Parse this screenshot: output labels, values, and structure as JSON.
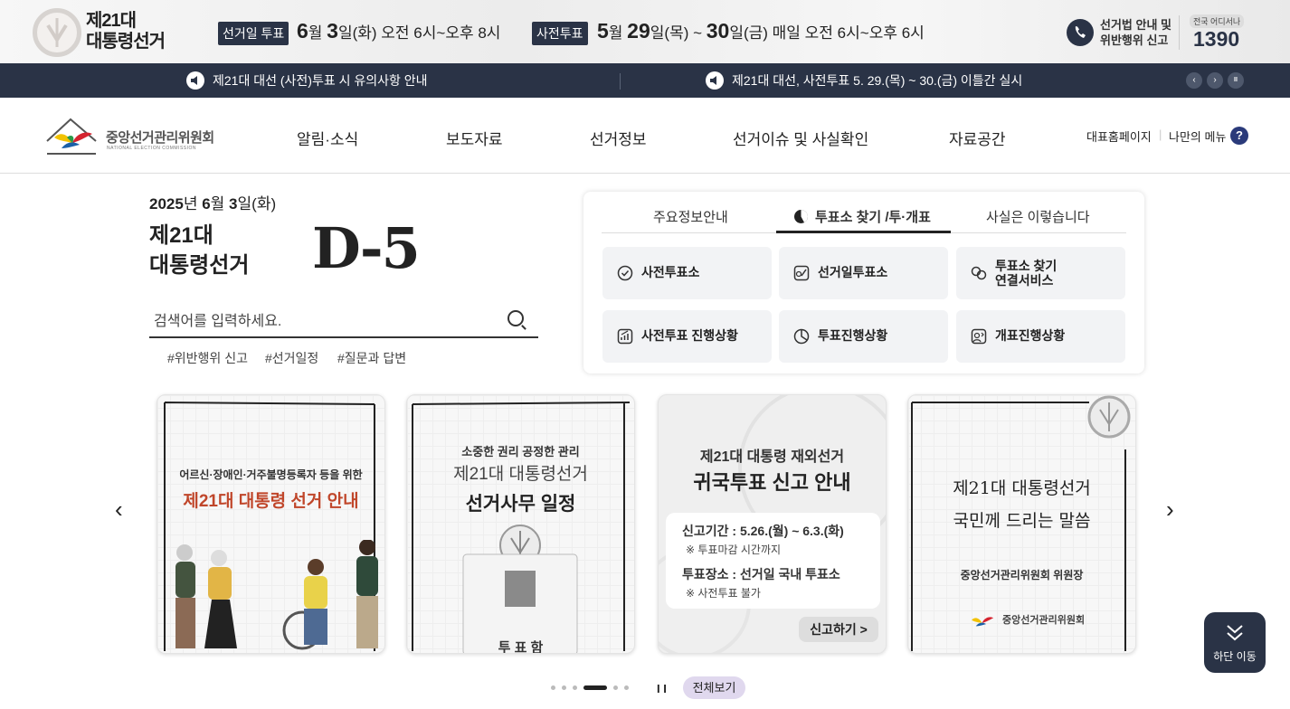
{
  "banner": {
    "brand_line1": "제21대",
    "brand_line2": "대통령선거",
    "election_day_tag": "선거일 투표",
    "election_day_month": "6",
    "election_day_month_unit": "월",
    "election_day_date": "3",
    "election_day_rest": "일(화) 오전 6시~오후 8시",
    "early_vote_tag": "사전투표",
    "early_vote_month": "5",
    "early_vote_month_unit": "월",
    "early_vote_start": "29",
    "early_vote_mid": "일(목) ~ ",
    "early_vote_end": "30",
    "early_vote_rest": "일(금) 매일 오전 6시~오후 6시",
    "hotline_line1": "선거법 안내 및",
    "hotline_line2": "위반행위 신고",
    "hotline_small": "전국 어디서나",
    "hotline_number": "1390"
  },
  "notices": [
    {
      "text": "제21대 대선 (사전)투표 시 유의사항 안내"
    },
    {
      "text": "제21대 대선, 사전투표 5. 29.(목) ~ 30.(금) 이틀간 실시"
    }
  ],
  "notice_controls": {
    "prev": "‹",
    "next": "›",
    "pause": "II"
  },
  "gnb": {
    "org_name": "중앙선거관리위원회",
    "org_name_en": "NATIONAL ELECTION COMMISSION",
    "menu": [
      "알림·소식",
      "보도자료",
      "선거정보",
      "선거이슈 및 사실확인",
      "자료공간"
    ],
    "util_home": "대표홈페이지",
    "util_my": "나만의 메뉴",
    "help": "?"
  },
  "hero": {
    "date_year": "2025",
    "date_year_unit": "년 ",
    "date_month": "6",
    "date_month_unit": "월 ",
    "date_day": "3",
    "date_rest": "일(화)",
    "election_line1": "제21대",
    "election_line2": "대통령선거",
    "dday": "D-5",
    "search_placeholder": "검색어를 입력하세요.",
    "hashtags": [
      "#위반행위 신고",
      "#선거일정",
      "#질문과 답변"
    ]
  },
  "panel": {
    "tabs": [
      "주요정보안내",
      "투표소 찾기 /투·개표",
      "사실은 이렇습니다"
    ],
    "buttons": [
      {
        "label": "사전투표소",
        "icon": "check-circle-icon"
      },
      {
        "label": "선거일투표소",
        "icon": "ballot-icon"
      },
      {
        "label_line1": "투표소 찾기",
        "label_line2": "연결서비스",
        "icon": "link-icon"
      },
      {
        "label": "사전투표 진행상황",
        "icon": "growth-chart-icon"
      },
      {
        "label": "투표진행상황",
        "icon": "pie-chart-icon"
      },
      {
        "label": "개표진행상황",
        "icon": "person-board-icon"
      }
    ]
  },
  "cards": [
    {
      "line1": "어르신·장애인·거주불명등록자 등을 위한",
      "line2": "제21대 대통령 선거 안내"
    },
    {
      "line1": "소중한 권리 공정한 관리",
      "line2": "제21대 대통령선거",
      "line3": "선거사무 일정",
      "box_label": "투 표 함"
    },
    {
      "line1": "제21대 대통령 재외선거",
      "line2": "귀국투표 신고 안내",
      "info1": "신고기간 : 5.26.(월) ~ 6.3.(화)",
      "info1_note": "※ 투표마감 시간까지",
      "info2": "투표장소 : 선거일 국내 투표소",
      "info2_note": "※ 사전투표 불가",
      "cta": "신고하기 >"
    },
    {
      "line1": "제21대 대통령선거",
      "line2": "국민께 드리는 말씀",
      "line3": "중앙선거관리위원회 위원장",
      "org": "중앙선거관리위원회"
    }
  ],
  "carousel": {
    "prev": "‹",
    "next": "›",
    "pause": "I I",
    "view_all": "전체보기"
  },
  "go_down": "하단 이동",
  "colors": {
    "navy": "#2a3346",
    "accent_orange": "#c0462a",
    "view_all_bg": "#e0d8ee"
  }
}
